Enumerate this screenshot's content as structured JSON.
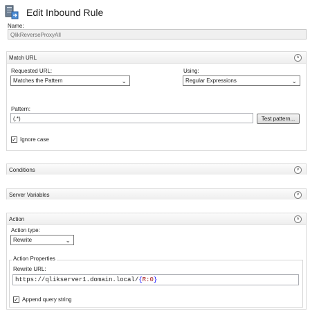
{
  "header": {
    "title": "Edit Inbound Rule",
    "icon": "inbound-rule-icon"
  },
  "name_field": {
    "label": "Name:",
    "value": "QlikReverseProxyAll"
  },
  "match_url": {
    "title": "Match URL",
    "toggle": "up",
    "requested_url_label": "Requested URL:",
    "requested_url_value": "Matches the Pattern",
    "using_label": "Using:",
    "using_value": "Regular Expressions",
    "pattern_label": "Pattern:",
    "pattern_value": "(.*)",
    "test_pattern_label": "Test pattern...",
    "ignore_case_label": "Ignore case",
    "ignore_case_checked": true
  },
  "conditions": {
    "title": "Conditions",
    "toggle": "down"
  },
  "server_variables": {
    "title": "Server Variables",
    "toggle": "down"
  },
  "action": {
    "title": "Action",
    "toggle": "up",
    "action_type_label": "Action type:",
    "action_type_value": "Rewrite",
    "properties_title": "Action Properties",
    "rewrite_url_label": "Rewrite URL:",
    "rewrite_url_prefix": "https://qlikserver1.domain.local/",
    "rewrite_url_open": "{",
    "rewrite_url_var": "R:0",
    "rewrite_url_close": "}",
    "append_query_label": "Append query string",
    "append_query_checked": true
  },
  "colors": {
    "section_border": "#dadada",
    "brace_blue": "#0000ff",
    "var_red": "#a31515"
  }
}
